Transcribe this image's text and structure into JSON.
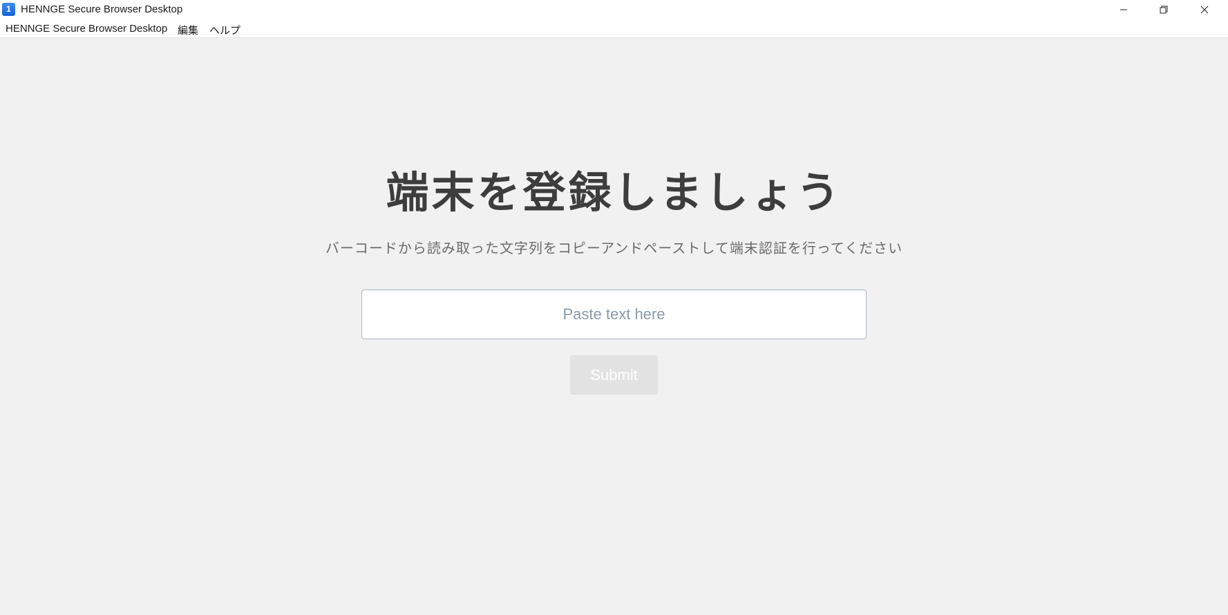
{
  "window": {
    "title": "HENNGE Secure Browser Desktop",
    "icon_glyph": "1",
    "controls": [
      "minimize-icon",
      "restore-icon",
      "close-icon"
    ]
  },
  "menubar": {
    "items": [
      {
        "label": "HENNGE Secure Browser Desktop"
      },
      {
        "label": "編集"
      },
      {
        "label": "ヘルプ"
      }
    ]
  },
  "main": {
    "heading": "端末を登録しましょう",
    "subtitle": "バーコードから読み取った文字列をコピーアンドペーストして端末認証を行ってください",
    "input": {
      "placeholder": "Paste text here",
      "value": ""
    },
    "submit_label": "Submit"
  },
  "colors": {
    "background": "#f1f1f1",
    "heading": "#3d3d3d",
    "subtitle": "#6a6a6a",
    "input_border": "#a9b4c2",
    "placeholder": "#8a9aab",
    "submit_disabled_bg": "#e2e2e2",
    "app_icon": "#1663d6"
  }
}
